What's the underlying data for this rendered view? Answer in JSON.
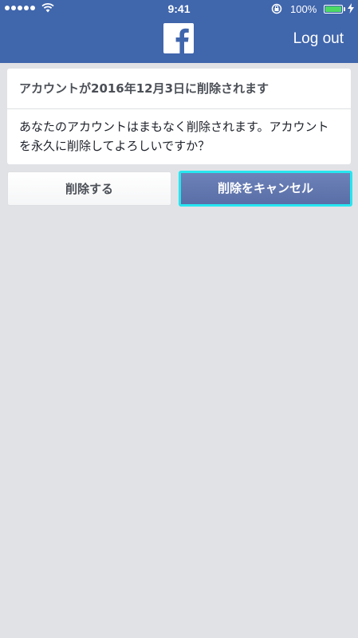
{
  "status_bar": {
    "time": "9:41",
    "battery_percent": "100%",
    "battery_level": 1.0,
    "signal_bars": 5,
    "icons": [
      "signal-dots-icon",
      "wifi-icon",
      "rotation-lock-icon",
      "battery-icon",
      "charging-bolt-icon"
    ]
  },
  "header": {
    "logo_icon": "facebook-logo-icon",
    "logout_label": "Log out",
    "background_color": "#4066ac"
  },
  "notice": {
    "title": "アカウントが2016年12月3日に削除されます",
    "message": "あなたのアカウントはまもなく削除されます。アカウントを永久に削除してよろしいですか？"
  },
  "actions": {
    "delete_label": "削除する",
    "cancel_delete_label": "削除をキャンセル",
    "highlight_color": "#27e6f0"
  }
}
